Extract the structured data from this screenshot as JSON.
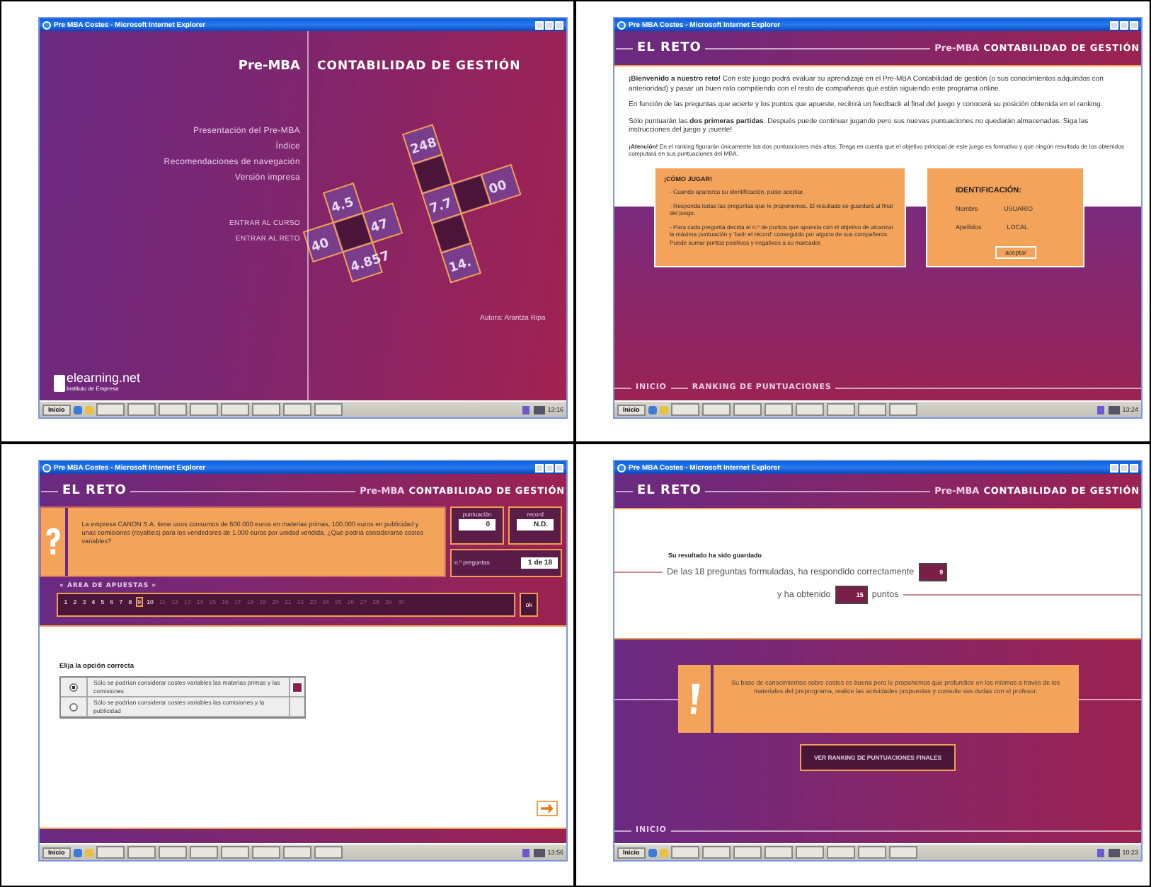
{
  "screens": [
    {
      "kind": "intro",
      "window_title": "Pre MBA Costes - Microsoft Internet Explorer",
      "brand": "Pre-MBA",
      "course": "CONTABILIDAD DE GESTIÓN",
      "menu": [
        "Presentación del Pre-MBA",
        "Índice",
        "Recomendaciones de navegación",
        "Versión impresa"
      ],
      "actions": [
        "ENTRAR AL CURSO",
        "ENTRAR AL RETO"
      ],
      "crossword_numbers": [
        "4.5",
        "248",
        "40",
        "47",
        "7.7",
        "00",
        "4.857",
        "14."
      ],
      "author": "Autora: Arantza Ripa",
      "logo": "elearning.net",
      "logo_subtitle": "Instituto de Empresa",
      "taskbar": {
        "start": "Inicio",
        "clock": "13:16"
      }
    },
    {
      "kind": "welcome",
      "window_title": "Pre MBA Costes - Microsoft Internet Explorer",
      "section": "EL RETO",
      "brand": "Pre-MBA",
      "course": "CONTABILIDAD DE GESTIÓN",
      "paragraphs": [
        "**¡Bienvenido a nuestro reto!** Con este juego podrá evaluar su aprendizaje en el Pre-MBA Contabilidad de gestión (o sus conocimientos adquiridos con anterioridad) y pasar un buen rato compitiendo con el resto de compañeros que están siguiendo este programa online.",
        "En función de las preguntas que acierte y los puntos que apueste, recibirá un feedback al final del juego y conocerá su posición obtenida en el ranking.",
        "Sólo puntuarán las **dos primeras partidas**. Después puede continuar jugando pero sus nuevas puntuaciones no quedarán almacenadas. Siga las instrucciones del juego y ¡suerte!"
      ],
      "notice": "**¡Atención!** En el ranking figurarán únicamente las dos puntuaciones más altas. Tenga en cuenta que el objetivo principal de este juego es formativo y que ningún resultado de los obtenidos computará en sus puntuaciones del MBA.",
      "howto_title": "¡CÓMO JUGAR!",
      "howto_items": [
        "- Cuando aparezca su identificación, pulse aceptar.",
        "- Responda todas las preguntas que le proponemos. El resultado se guardará al final del juego.",
        "- Para cada pregunta decida el n.º de puntos que apuesta con el objetivo de alcanzar la máxima puntuación y 'batir el récord' conseguido por alguno de sus compañeros. Puede sumar puntos positivos y negativos a su marcador."
      ],
      "id_title": "IDENTIFICACIÓN:",
      "id_fields": [
        {
          "label": "Nombre",
          "value": "USUARIO"
        },
        {
          "label": "Apellidos",
          "value": "LOCAL"
        }
      ],
      "accept_button": "aceptar",
      "footer_links": [
        "INICIO",
        "RANKING DE PUNTUACIONES"
      ],
      "taskbar": {
        "start": "Inicio",
        "clock": "13:24"
      }
    },
    {
      "kind": "question",
      "window_title": "Pre MBA Costes - Microsoft Internet Explorer",
      "section": "EL RETO",
      "brand": "Pre-MBA",
      "course": "CONTABILIDAD DE GESTIÓN",
      "question": "La empresa CANON S.A. tiene unos consumos de 600.000 euros en materias primas, 100.000 euros en publicidad y unas comisiones (royalties) para los vendedores de 1.000 euros por unidad vendida. ¿Qué podría considerarse costes variables?",
      "stats": [
        {
          "label": "puntuación",
          "value": "0"
        },
        {
          "label": "record",
          "value": "N.D."
        },
        {
          "label": "n.º preguntas",
          "value": "1 de 18"
        }
      ],
      "bets_label": "« ÁREA DE APUESTAS »",
      "bets": [
        {
          "label": "1",
          "selected": false,
          "disabled": false
        },
        {
          "label": "2",
          "selected": false,
          "disabled": false
        },
        {
          "label": "3",
          "selected": false,
          "disabled": false
        },
        {
          "label": "4",
          "selected": false,
          "disabled": false
        },
        {
          "label": "5",
          "selected": false,
          "disabled": false
        },
        {
          "label": "6",
          "selected": false,
          "disabled": false
        },
        {
          "label": "7",
          "selected": false,
          "disabled": false
        },
        {
          "label": "8",
          "selected": false,
          "disabled": false
        },
        {
          "label": "9",
          "selected": true,
          "disabled": false
        },
        {
          "label": "10",
          "selected": false,
          "disabled": false
        },
        {
          "label": "11",
          "selected": false,
          "disabled": true
        },
        {
          "label": "12",
          "selected": false,
          "disabled": true
        },
        {
          "label": "13",
          "selected": false,
          "disabled": true
        },
        {
          "label": "14",
          "selected": false,
          "disabled": true
        },
        {
          "label": "15",
          "selected": false,
          "disabled": true
        },
        {
          "label": "16",
          "selected": false,
          "disabled": true
        },
        {
          "label": "17",
          "selected": false,
          "disabled": true
        },
        {
          "label": "18",
          "selected": false,
          "disabled": true
        },
        {
          "label": "19",
          "selected": false,
          "disabled": true
        },
        {
          "label": "20",
          "selected": false,
          "disabled": true
        },
        {
          "label": "21",
          "selected": false,
          "disabled": true
        },
        {
          "label": "22",
          "selected": false,
          "disabled": true
        },
        {
          "label": "23",
          "selected": false,
          "disabled": true
        },
        {
          "label": "24",
          "selected": false,
          "disabled": true
        },
        {
          "label": "25",
          "selected": false,
          "disabled": true
        },
        {
          "label": "26",
          "selected": false,
          "disabled": true
        },
        {
          "label": "27",
          "selected": false,
          "disabled": true
        },
        {
          "label": "28",
          "selected": false,
          "disabled": true
        },
        {
          "label": "29",
          "selected": false,
          "disabled": true
        },
        {
          "label": "30",
          "selected": false,
          "disabled": true
        }
      ],
      "ok_button": "ok",
      "prompt": "Elija la opción correcta",
      "options": [
        {
          "text": "Sólo se podrían considerar costes variables las materias primas y las comisiones",
          "selected": true,
          "checked": true
        },
        {
          "text": "Sólo se podrían considerar costes variables las comisiones y la publicidad",
          "selected": false,
          "checked": false
        }
      ],
      "taskbar": {
        "start": "Inicio",
        "clock": "13:56"
      }
    },
    {
      "kind": "result",
      "window_title": "Pre MBA Costes - Microsoft Internet Explorer",
      "section": "EL RETO",
      "brand": "Pre-MBA",
      "course": "CONTABILIDAD DE GESTIÓN",
      "saved": "Su resultado ha sido guardado",
      "line1": "De las 18 preguntas formuladas, ha respondido correctamente",
      "correct": "9",
      "line2": "y ha obtenido",
      "points": "15",
      "points_label": "puntos",
      "feedback": "Su base de conocimientos sobre costes es buena pero le proponemos que profundice en los mismos a través de los materiales del preprograma, realice las actividades propuestas y consulte sus dudas con el profesor.",
      "ranking_button": "VER RANKING DE PUNTUACIONES FINALES",
      "footer_links": [
        "INICIO"
      ],
      "taskbar": {
        "start": "Inicio",
        "clock": "10:23"
      }
    }
  ]
}
